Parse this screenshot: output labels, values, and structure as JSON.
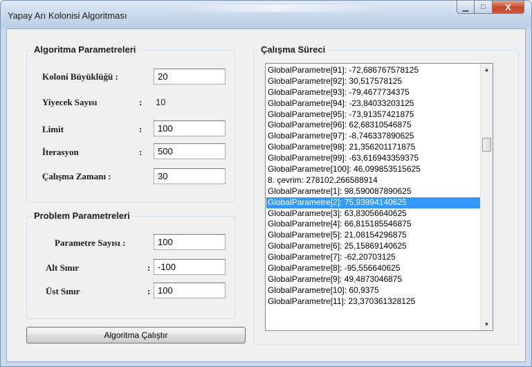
{
  "window": {
    "title": "Yapay Arı Kolonisi Algoritması",
    "min_glyph": "▁",
    "max_glyph": "□",
    "close_glyph": "X"
  },
  "algorithm_params": {
    "title": "Algoritma Parametreleri",
    "colony_size": {
      "label": "Koloni Büyüklüğü :",
      "value": "20"
    },
    "food_count": {
      "label": "Yiyecek Sayısı",
      "colon": ":",
      "value": "10"
    },
    "limit": {
      "label": "Limit",
      "colon": ":",
      "value": "100"
    },
    "iteration": {
      "label": "İterasyon",
      "colon": ":",
      "value": "500"
    },
    "run_time": {
      "label": "Çalışma Zamanı :",
      "value": "30"
    }
  },
  "problem_params": {
    "title": "Problem Parametreleri",
    "param_count": {
      "label": "Parametre Sayısı :",
      "value": "100"
    },
    "lower_bound": {
      "label": "Alt Sınır",
      "colon": ":",
      "value": "-100"
    },
    "upper_bound": {
      "label": "Üst Sınır",
      "colon": ":",
      "value": "100"
    }
  },
  "process": {
    "title": "Çalışma Süreci",
    "selected_index": 12,
    "items": [
      "GlobalParametre[91]: -72,686767578125",
      "GlobalParametre[92]: 30,517578125",
      "GlobalParametre[93]: -79,4677734375",
      "GlobalParametre[94]: -23,84033203125",
      "GlobalParametre[95]: -73,91357421875",
      "GlobalParametre[96]: 62,68310546875",
      "GlobalParametre[97]: -8,746337890625",
      "GlobalParametre[98]: 21,356201171875",
      "GlobalParametre[99]: -63,616943359375",
      "GlobalParametre[100]: 46,099853515625",
      "8. çevrim: 278102,266588914",
      "GlobalParametre[1]: 98,590087890625",
      "GlobalParametre[2]: 75,93994140625",
      "GlobalParametre[3]: 63,83056640625",
      "GlobalParametre[4]: 66,815185546875",
      "GlobalParametre[5]: 21,08154296875",
      "GlobalParametre[6]: 25,15869140625",
      "GlobalParametre[7]: -62,20703125",
      "GlobalParametre[8]: -95,556640625",
      "GlobalParametre[9]: 49,4873046875",
      "GlobalParametre[10]: 60,9375",
      "GlobalParametre[11]: 23,370361328125"
    ]
  },
  "run_button": {
    "label": "Algoritma Çalıştır"
  },
  "colors": {
    "selection": "#3399ff",
    "window_frame": "#c9daee",
    "close_button": "#c4472a"
  }
}
